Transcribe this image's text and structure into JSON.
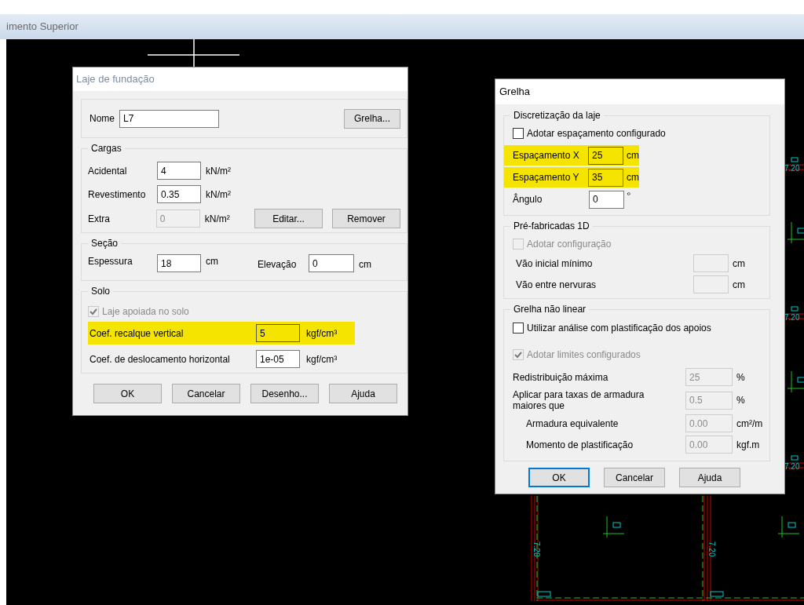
{
  "app_title": "imento Superior",
  "foundation_dialog": {
    "title": "Laje de fundação",
    "name": {
      "label": "Nome",
      "value": "L7"
    },
    "grid_button": "Grelha...",
    "loads": {
      "title": "Cargas",
      "rows": [
        {
          "label": "Acidental",
          "value": "4",
          "unit": "kN/m²",
          "disabled": false
        },
        {
          "label": "Revestimento",
          "value": "0.35",
          "unit": "kN/m²",
          "disabled": false
        },
        {
          "label": "Extra",
          "value": "0",
          "unit": "kN/m²",
          "disabled": true
        }
      ],
      "edit_button": "Editar...",
      "remove_button": "Remover"
    },
    "section": {
      "title": "Seção",
      "thickness": {
        "label": "Espessura",
        "value": "18",
        "unit": "cm"
      },
      "elevation": {
        "label": "Elevação",
        "value": "0",
        "unit": "cm"
      }
    },
    "soil": {
      "title": "Solo",
      "supported": {
        "label": "Laje apoiada no solo",
        "checked": true,
        "disabled": true
      },
      "rows": [
        {
          "label": "Coef. recalque vertical",
          "value": "5",
          "unit": "kgf/cm³",
          "highlighted": true
        },
        {
          "label": "Coef. de deslocamento horizontal",
          "value": "1e-05",
          "unit": "kgf/cm³",
          "highlighted": false
        }
      ]
    },
    "buttons": [
      {
        "label": "OK",
        "default": false
      },
      {
        "label": "Cancelar",
        "default": false
      },
      {
        "label": "Desenho...",
        "default": false
      },
      {
        "label": "Ajuda",
        "default": false
      }
    ]
  },
  "grid_dialog": {
    "title": "Grelha",
    "discretization": {
      "title": "Discretização da laje",
      "adopt": {
        "label": "Adotar espaçamento configurado",
        "checked": false,
        "disabled": false
      },
      "rows": [
        {
          "label": "Espaçamento X",
          "value": "25",
          "unit": "cm",
          "highlighted": true,
          "focused": false
        },
        {
          "label": "Espaçamento Y",
          "value": "35",
          "unit": "cm",
          "highlighted": true,
          "focused": true
        },
        {
          "label": "Ângulo",
          "value": "0",
          "unit": "º",
          "highlighted": false,
          "focused": false
        }
      ]
    },
    "precast": {
      "title": "Pré-fabricadas 1D",
      "adopt": {
        "label": "Adotar configuração",
        "checked": false,
        "disabled": true
      },
      "rows": [
        {
          "label": "Vão inicial mínimo",
          "unit": "cm",
          "disabled": true
        },
        {
          "label": "Vão entre nervuras",
          "unit": "cm",
          "disabled": true
        }
      ]
    },
    "nonlinear": {
      "title": "Grelha não linear",
      "use": {
        "label": "Utilizar análise com plastificação dos apoios",
        "checked": false,
        "disabled": false
      },
      "limits": {
        "label": "Adotar limites configurados",
        "checked": true,
        "disabled": true
      },
      "rows": [
        {
          "label": "Redistribuição máxima",
          "value": "25",
          "unit": "%",
          "indented": false,
          "disabled": true
        },
        {
          "label": "Aplicar para taxas de armadura maiores que",
          "value": "0.5",
          "unit": "%",
          "indented": false,
          "disabled": true
        },
        {
          "label": "Armadura equivalente",
          "value": "0.00",
          "unit": "cm²/m",
          "indented": true,
          "disabled": true
        },
        {
          "label": "Momento de plastificação",
          "value": "0.00",
          "unit": "kgf.m",
          "indented": true,
          "disabled": true
        }
      ]
    },
    "buttons": [
      {
        "label": "OK",
        "default": true
      },
      {
        "label": "Cancelar",
        "default": false
      },
      {
        "label": "Ajuda",
        "default": false
      }
    ]
  },
  "canvas_labels": [
    {
      "text": "7.20",
      "kind": "horizontal"
    },
    {
      "text": "7.20",
      "kind": "horizontal"
    },
    {
      "text": "7.20",
      "kind": "horizontal"
    },
    {
      "text": "7.20",
      "kind": "vertical"
    },
    {
      "text": "7.20",
      "kind": "vertical"
    }
  ]
}
